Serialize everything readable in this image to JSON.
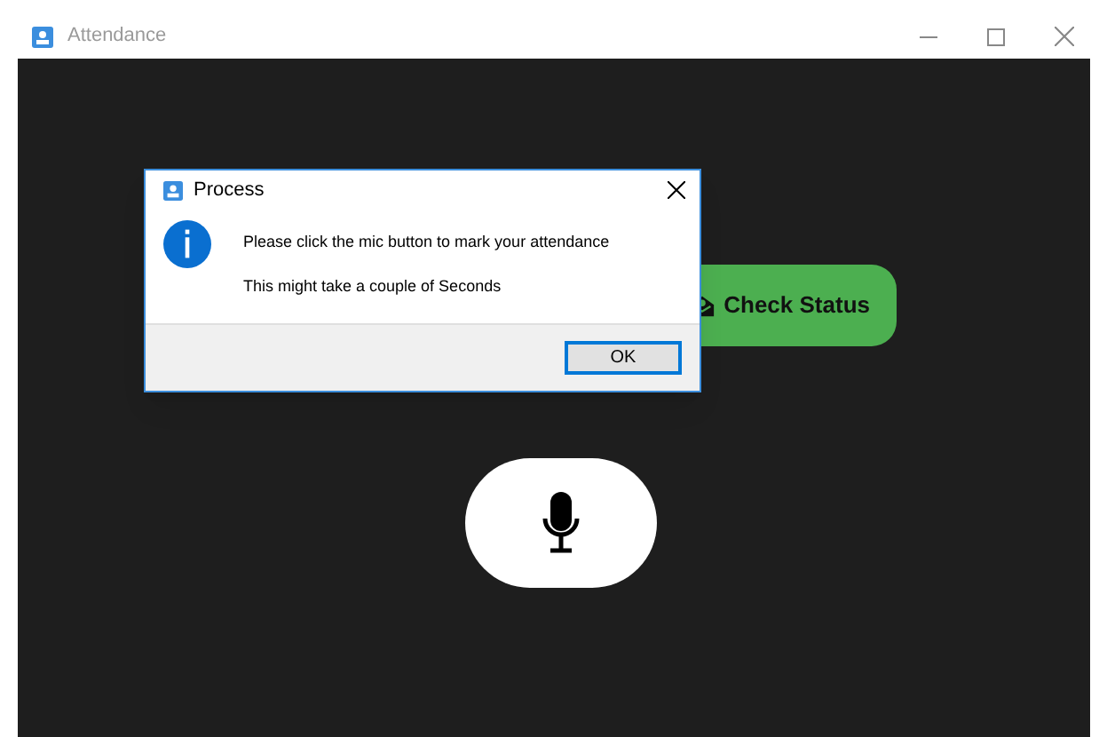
{
  "window": {
    "title": "Attendance"
  },
  "main": {
    "status_button": {
      "label": "Check Status"
    }
  },
  "dialog": {
    "title": "Process",
    "message": "Please click the mic button to mark your attendance",
    "detail": "This might take a couple of Seconds",
    "buttons": [
      {
        "label": "OK",
        "selected": true
      }
    ]
  }
}
